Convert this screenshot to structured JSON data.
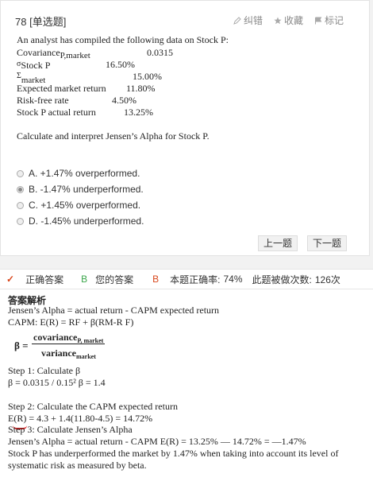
{
  "question": {
    "number": "78",
    "type": "[单选题]",
    "tools": {
      "report": "纠错",
      "favorite": "收藏",
      "mark": "标记"
    },
    "intro": "An analyst has compiled the following data on Stock P:",
    "data": [
      {
        "label": "Covariance",
        "sub": "P,market",
        "value": "0.0315"
      },
      {
        "label": "Stock P",
        "pre": "σ",
        "value": "16.50%"
      },
      {
        "label": "",
        "pre": "Σ",
        "sub": "market",
        "value": "15.00%"
      },
      {
        "label": "Expected market return",
        "value": "11.80%"
      },
      {
        "label": "Risk-free rate",
        "value": "4.50%"
      },
      {
        "label": "Stock P actual return",
        "value": "13.25%"
      }
    ],
    "prompt": "Calculate and interpret Jensen’s Alpha for Stock P.",
    "options": [
      {
        "text": "A. +1.47% overperformed.",
        "selected": false
      },
      {
        "text": "B. -1.47% underperformed.",
        "selected": true
      },
      {
        "text": "C. +1.45% overperformed.",
        "selected": false
      },
      {
        "text": "D. -1.45% underperformed.",
        "selected": false
      }
    ],
    "prev": "上一题",
    "next": "下一题"
  },
  "status": {
    "correct_label": "正确答案",
    "correct_value": "B",
    "your_label": "您的答案",
    "your_value": "B",
    "rate_label": "本题正确率:",
    "rate_value": "74%",
    "count_label": "此题被做次数:",
    "count_value": "126次"
  },
  "explanation": {
    "title": "答案解析",
    "l1": "Jensen’s Alpha = actual return - CAPM expected return",
    "l2": "CAPM: E(R) = RF + β(RM-R F)",
    "beta": "β =",
    "frac_num": "covariance",
    "frac_num_sub": "P, market",
    "frac_den": "variance",
    "frac_den_sub": "market",
    "step1": "Step 1: Calculate β",
    "step1b": "β = 0.0315 / 0.15²  β = 1.4",
    "step2": "Step 2: Calculate the CAPM expected return",
    "step2b": "E(R) = 4.3 + 1.4(11.80-4.5) = 14.72%",
    "step3": "Step 3: Calculate Jensen’s Alpha",
    "step3b": "Jensen’s Alpha = actual return - CAPM E(R) = 13.25% — 14.72% = —1.47%",
    "step3c": "Stock P has underperformed the market by 1.47% when taking into account its level of",
    "step3d": "systematic risk as measured by beta."
  }
}
